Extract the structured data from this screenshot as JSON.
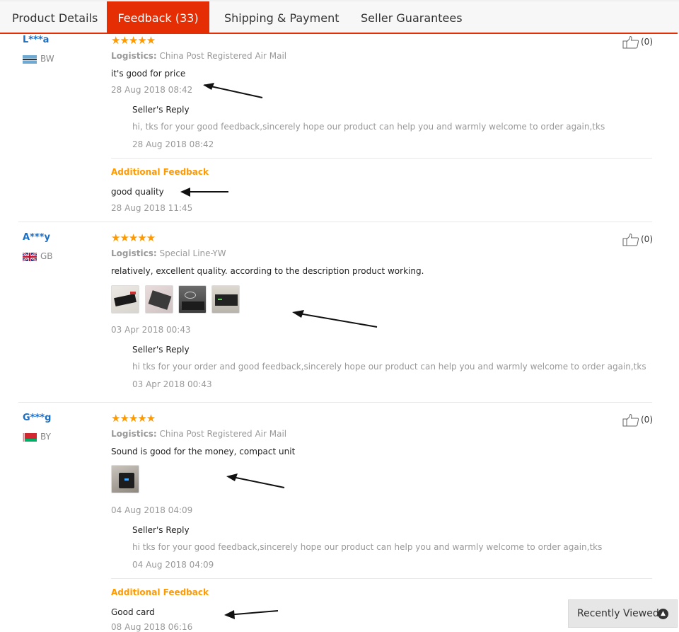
{
  "tabs": [
    {
      "label": "Product Details"
    },
    {
      "label": "Feedback (33)"
    },
    {
      "label": "Shipping & Payment"
    },
    {
      "label": "Seller Guarantees"
    }
  ],
  "colors": {
    "accent": "#e62e04",
    "star": "#ff9900",
    "username": "#1a6fc5",
    "additional": "#ff9900"
  },
  "reviews": [
    {
      "user": "L***a",
      "country": "BW",
      "rating": 5,
      "stars": "★★★★★",
      "logistics_label": "Logistics:",
      "logistics": "China Post Registered Air Mail",
      "text": "it's good for price",
      "date": "28 Aug 2018 08:42",
      "like": "(0)",
      "reply_title": "Seller's Reply",
      "reply_text": "hi, tks for your good feedback,sincerely hope our product can help you and warmly welcome to order again,tks",
      "reply_date": "28 Aug 2018 08:42",
      "additional_title": "Additional Feedback",
      "additional_text": "good quality",
      "additional_date": "28 Aug 2018 11:45"
    },
    {
      "user": "A***y",
      "country": "GB",
      "rating": 5,
      "stars": "★★★★★",
      "logistics_label": "Logistics:",
      "logistics": "Special Line-YW",
      "text": "relatively, excellent quality. according to the description product working.",
      "date": "03 Apr 2018 00:43",
      "like": "(0)",
      "reply_title": "Seller's Reply",
      "reply_text": "hi tks for your order and good feedback,sincerely hope our product can help you and warmly welcome to order again,tks",
      "reply_date": "03 Apr 2018 00:43"
    },
    {
      "user": "G***g",
      "country": "BY",
      "rating": 5,
      "stars": "★★★★★",
      "logistics_label": "Logistics:",
      "logistics": "China Post Registered Air Mail",
      "text": "Sound is good for the money, compact unit",
      "date": "04 Aug 2018 04:09",
      "like": "(0)",
      "reply_title": "Seller's Reply",
      "reply_text": "hi tks for your good feedback,sincerely hope our product can help you and warmly welcome to order again,tks",
      "reply_date": "04 Aug 2018 04:09",
      "additional_title": "Additional Feedback",
      "additional_text": "Good card",
      "additional_date": "08 Aug 2018 06:16"
    }
  ],
  "recently_viewed": {
    "label": "Recently Viewed",
    "icon": "chevron-up-icon"
  }
}
